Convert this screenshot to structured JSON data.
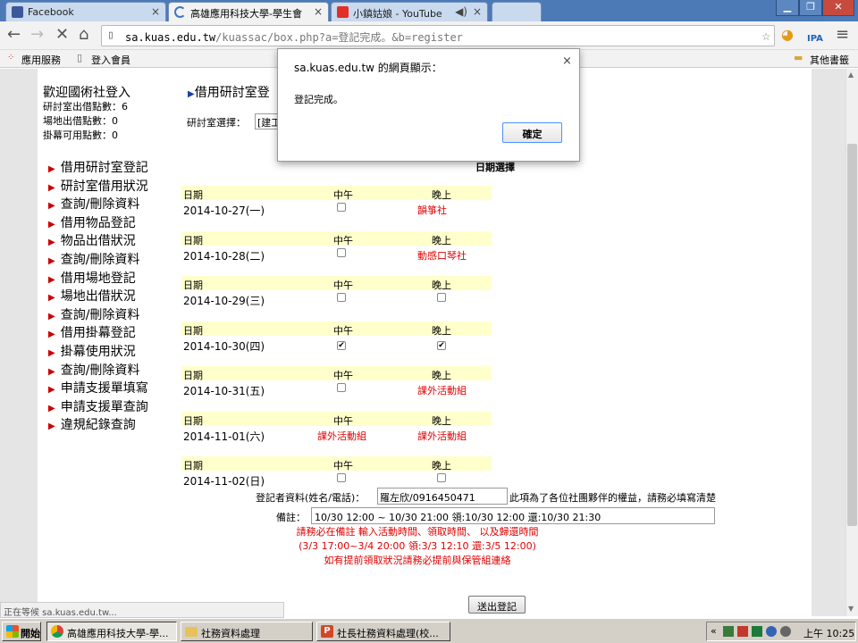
{
  "browser": {
    "tabs": [
      {
        "title": "Facebook",
        "color": "#3b5998"
      },
      {
        "title": "高雄應用科技大學-學生會",
        "color": "#3a78c2"
      },
      {
        "title": "小鎮姑娘 - YouTube",
        "color": "#e52d27"
      }
    ],
    "url_host": "sa.kuas.edu.tw",
    "url_path": "/kuassac/box.php?a=登記完成。&b=register",
    "bookmarks": [
      "應用服務",
      "登入會員"
    ],
    "other_bookmarks": "其他書籤",
    "status": "正在等候 sa.kuas.edu.tw..."
  },
  "sidebar": {
    "welcome": "歡迎國術社登入",
    "stats": [
      "研討室出借點數：6",
      "場地出借點數：0",
      "掛幕可用點數：0"
    ],
    "nav": [
      "借用研討室登記",
      "研討室借用狀況",
      "查詢/刪除資料",
      "借用物品登記",
      "物品出借狀況",
      "查詢/刪除資料",
      "借用場地登記",
      "場地出借狀況",
      "查詢/刪除資料",
      "借用掛幕登記",
      "掛幕使用狀況",
      "查詢/刪除資料",
      "申請支援單填寫",
      "申請支援單查詢",
      "違規紀錄查詢"
    ]
  },
  "main": {
    "heading": "借用研討室登",
    "room_select_label": "研討室選擇：",
    "room_select_value": "[建工",
    "date_select_label": "日期選擇",
    "col_date": "日期",
    "col_noon": "中午",
    "col_evening": "晚上",
    "rows": [
      {
        "date": "2014-10-27(一)",
        "noon": "",
        "noon_checked": false,
        "evening": "韻箏社",
        "evening_checked": false
      },
      {
        "date": "2014-10-28(二)",
        "noon": "",
        "noon_checked": false,
        "evening": "動感口琴社",
        "evening_checked": false
      },
      {
        "date": "2014-10-29(三)",
        "noon": "",
        "noon_checked": false,
        "evening": "",
        "evening_checked": false
      },
      {
        "date": "2014-10-30(四)",
        "noon": "",
        "noon_checked": true,
        "evening": "",
        "evening_checked": true
      },
      {
        "date": "2014-10-31(五)",
        "noon": "",
        "noon_checked": false,
        "evening": "課外活動組",
        "evening_checked": false
      },
      {
        "date": "2014-11-01(六)",
        "noon": "課外活動組",
        "noon_checked": false,
        "evening": "課外活動組",
        "evening_checked": false
      },
      {
        "date": "2014-11-02(日)",
        "noon": "",
        "noon_checked": false,
        "evening": "",
        "evening_checked": false
      }
    ],
    "registrant_label": "登記者資料(姓名/電話)：",
    "registrant_value": "羅左欣/0916450471",
    "registrant_note": "此項為了各位社團夥伴的權益，請務必填寫清楚",
    "remark_label": "備註：",
    "remark_value": "10/30 12:00 ~ 10/30 21:00 領:10/30 12:00 還:10/30 21:30",
    "warning_lines": [
      "請務必在備註 輸入活動時間、領取時間、 以及歸還時間",
      "(3/3 17:00~3/4 20:00 領:3/3 12:10 還:3/5 12:00)",
      "如有提前領取狀況請務必提前與保管組連絡"
    ],
    "submit_label": "送出登記"
  },
  "dialog": {
    "title": "sa.kuas.edu.tw 的網頁顯示：",
    "message": "登記完成。",
    "ok_label": "確定",
    "close": "×"
  },
  "taskbar": {
    "start": "開始",
    "items": [
      "高雄應用科技大學-學...",
      "社務資料處理",
      "社長社務資料處理(校..."
    ],
    "clock": "上午 10:25"
  }
}
